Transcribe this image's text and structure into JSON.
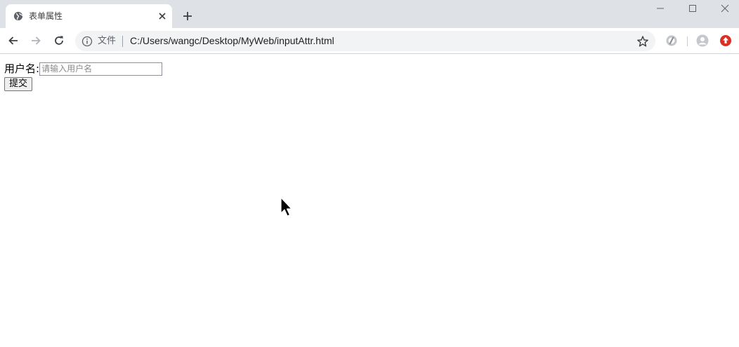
{
  "browser": {
    "tab": {
      "title": "表单属性",
      "favicon": "globe-icon",
      "close_icon": "close-icon"
    },
    "new_tab_icon": "plus-icon",
    "window_controls": [
      "minimize-icon",
      "maximize-icon",
      "close-icon"
    ],
    "toolbar": {
      "back_icon": "back-arrow-icon",
      "forward_icon": "forward-arrow-icon",
      "reload_icon": "reload-icon",
      "omnibox": {
        "info_icon": "info-icon",
        "scheme_label": "文件",
        "url": "C:/Users/wangc/Desktop/MyWeb/inputAttr.html",
        "star_icon": "star-icon"
      },
      "extensions": [
        "extension-icon",
        "profile-avatar-icon",
        "update-icon"
      ]
    }
  },
  "page": {
    "form": {
      "username_label": "用户名:",
      "username_placeholder": "请输入用户名",
      "username_value": "",
      "submit_label": "提交"
    }
  },
  "colors": {
    "tabstrip_bg": "#dee1e6",
    "omnibox_bg": "#f1f3f4",
    "update_badge": "#d93025"
  }
}
